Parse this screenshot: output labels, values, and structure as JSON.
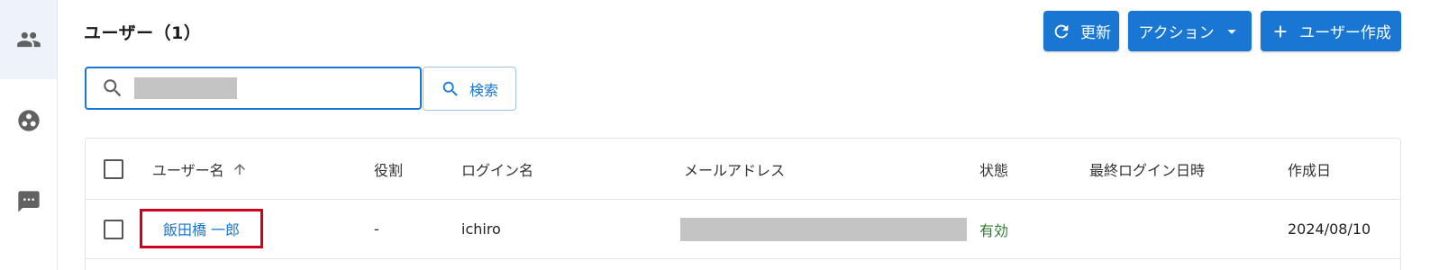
{
  "rail": {
    "items": [
      {
        "icon": "users-icon",
        "active": true
      },
      {
        "icon": "roles-icon",
        "active": false
      },
      {
        "icon": "messages-icon",
        "active": false
      }
    ]
  },
  "header": {
    "title": "ユーザー（1）"
  },
  "toolbar": {
    "refresh_label": "更新",
    "action_label": "アクション",
    "create_label": "ユーザー作成",
    "accent_color": "#1976d2"
  },
  "search": {
    "value": "",
    "button_label": "検索"
  },
  "table": {
    "columns": [
      "ユーザー名",
      "役割",
      "ログイン名",
      "メールアドレス",
      "状態",
      "最終ログイン日時",
      "作成日"
    ],
    "rows": [
      {
        "username": "飯田橋 一郎",
        "role": "-",
        "login": "ichiro",
        "email": "",
        "status": "有効",
        "last_login": "",
        "created": "2024/08/10"
      }
    ]
  },
  "colors": {
    "status_active": "#2e7d32",
    "highlight": "#d0021b"
  }
}
